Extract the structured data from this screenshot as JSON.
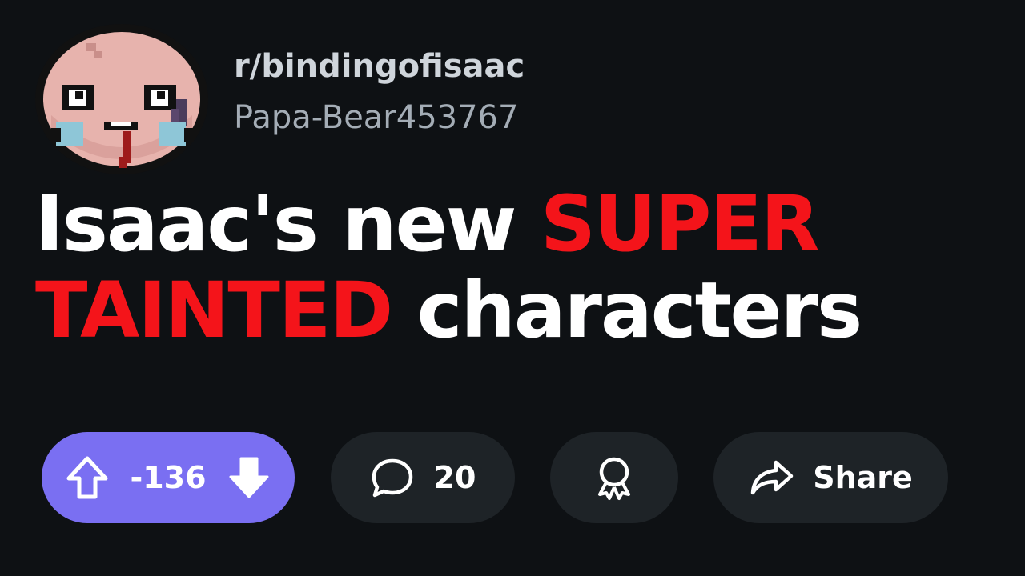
{
  "post": {
    "subreddit": "r/bindingofisaac",
    "author": "Papa-Bear453767",
    "title_line1_white": "Isaac's new ",
    "title_line1_red": "SUPER",
    "title_line2_red": "TAINTED",
    "title_line2_white": " characters"
  },
  "actions": {
    "vote_count": "-136",
    "comment_count": "20",
    "share_label": "Share"
  },
  "colors": {
    "background": "#0e1114",
    "accent_red": "#f4141a",
    "vote_pill": "#7a6ff2",
    "action_pill": "#1e2327"
  },
  "icons": {
    "upvote": "arrow-up-outline-icon",
    "downvote": "arrow-down-filled-icon",
    "comment": "speech-bubble-icon",
    "award": "award-ribbon-icon",
    "share": "share-arrow-icon"
  }
}
